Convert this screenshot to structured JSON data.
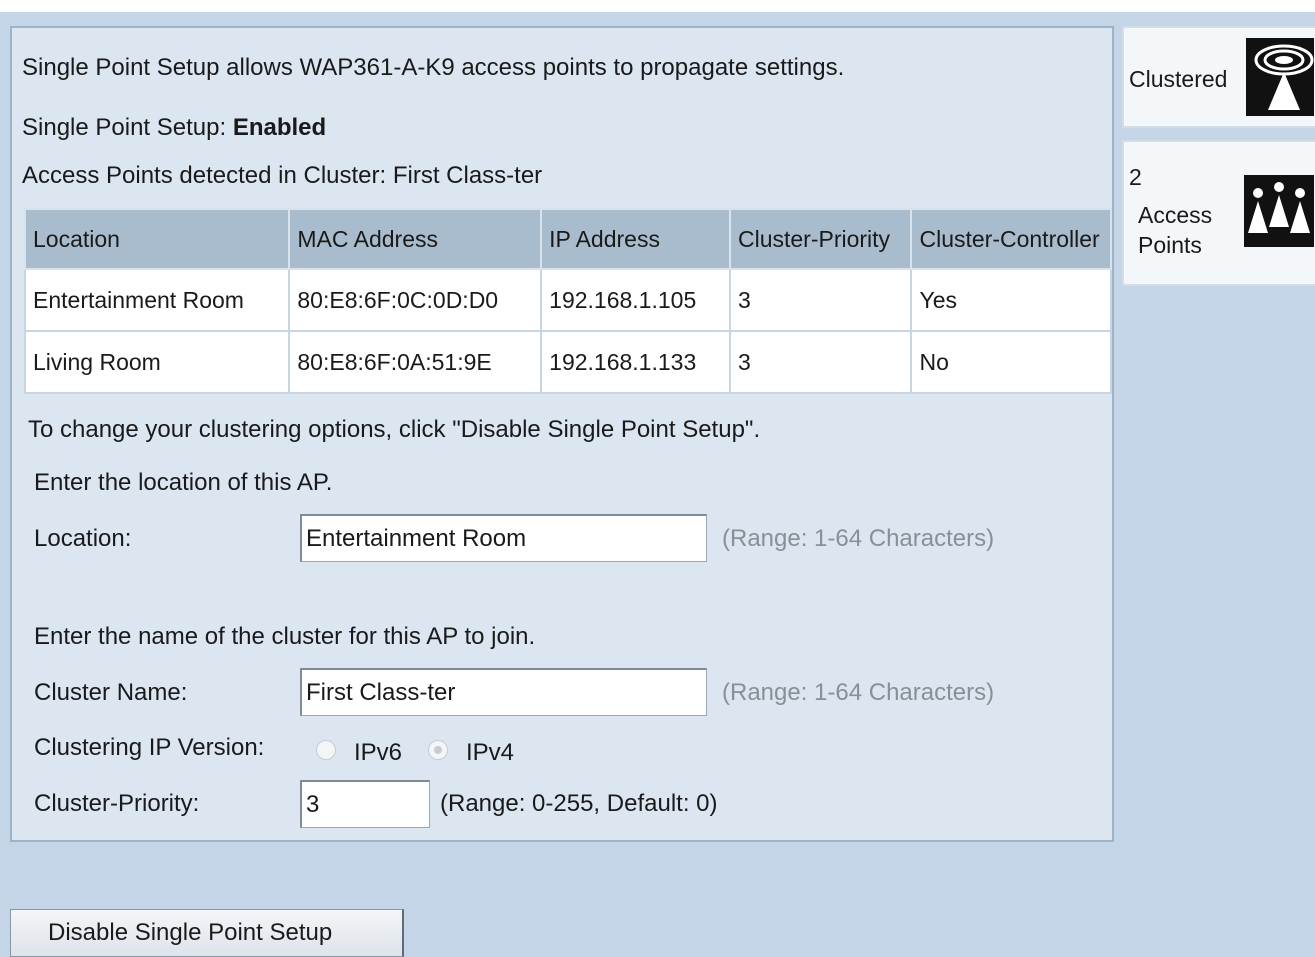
{
  "intro": "Single Point Setup allows WAP361-A-K9 access points to propagate settings.",
  "status": {
    "label": "Single Point Setup: ",
    "value": "Enabled"
  },
  "detected": "Access Points detected in Cluster: First Class-ter",
  "table": {
    "headers": [
      "Location",
      "MAC Address",
      "IP Address",
      "Cluster-Priority",
      "Cluster-Controller"
    ],
    "rows": [
      [
        "Entertainment Room",
        "80:E8:6F:0C:0D:D0",
        "192.168.1.105",
        "3",
        "Yes"
      ],
      [
        "Living Room",
        "80:E8:6F:0A:51:9E",
        "192.168.1.133",
        "3",
        "No"
      ]
    ]
  },
  "change_note": "To change your clustering options, click \"Disable Single Point Setup\".",
  "location_prompt": "Enter the location of this AP.",
  "location": {
    "label": "Location:",
    "value": "Entertainment Room",
    "hint": "(Range: 1-64 Characters)"
  },
  "cluster_prompt": "Enter the name of the cluster for this AP to join.",
  "cluster_name": {
    "label": "Cluster Name:",
    "value": "First Class-ter",
    "hint": "(Range: 1-64 Characters)"
  },
  "ip_version": {
    "label": "Clustering IP Version:",
    "options": [
      "IPv6",
      "IPv4"
    ],
    "selected": "IPv4"
  },
  "priority": {
    "label": "Cluster-Priority:",
    "value": "3",
    "hint": "(Range: 0-255, Default: 0)"
  },
  "disable_button": "Disable Single Point Setup",
  "sidebar": {
    "clustered": "Clustered",
    "count": "2",
    "access_points_line1": "Access",
    "access_points_line2": "Points",
    "icons": [
      "cluster-antenna-icon",
      "access-points-people-icon"
    ]
  }
}
